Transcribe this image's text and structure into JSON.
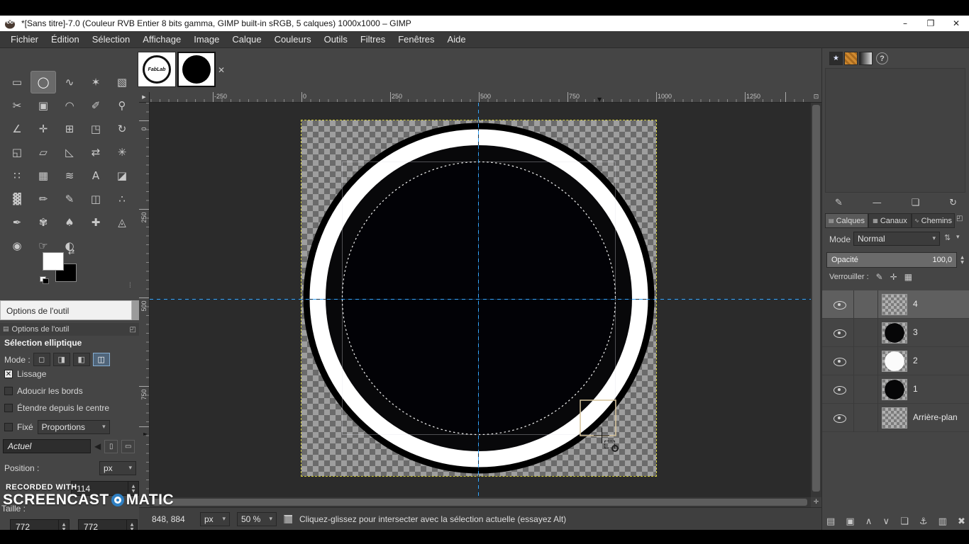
{
  "window": {
    "title": "*[Sans titre]-7.0 (Couleur RVB Entier 8 bits gamma, GIMP built-in sRGB, 5 calques) 1000x1000 – GIMP"
  },
  "menu_items": [
    "Fichier",
    "Édition",
    "Sélection",
    "Affichage",
    "Image",
    "Calque",
    "Couleurs",
    "Outils",
    "Filtres",
    "Fenêtres",
    "Aide"
  ],
  "image_tabs": {
    "logo_text": "FabLab"
  },
  "rulers": {
    "h": [
      "-250",
      "0",
      "250",
      "500",
      "750",
      "1000",
      "1250"
    ],
    "v": [
      "0",
      "250",
      "500",
      "750"
    ]
  },
  "toolbox": {
    "active_tool": "ellipse-select",
    "tools": [
      {
        "name": "rectangle-select",
        "glyph": "▭"
      },
      {
        "name": "ellipse-select",
        "glyph": "◯",
        "active": true
      },
      {
        "name": "free-select",
        "glyph": "∿"
      },
      {
        "name": "fuzzy-select",
        "glyph": "✶"
      },
      {
        "name": "select-by-color",
        "glyph": "▧"
      },
      {
        "name": "scissors-select",
        "glyph": "✂"
      },
      {
        "name": "foreground-select",
        "glyph": "▣"
      },
      {
        "name": "paths",
        "glyph": "◠"
      },
      {
        "name": "color-picker",
        "glyph": "✐"
      },
      {
        "name": "zoom",
        "glyph": "⚲"
      },
      {
        "name": "measure",
        "glyph": "∠"
      },
      {
        "name": "move",
        "glyph": "✛"
      },
      {
        "name": "alignment",
        "glyph": "⊞"
      },
      {
        "name": "crop",
        "glyph": "◳"
      },
      {
        "name": "rotate",
        "glyph": "↻"
      },
      {
        "name": "scale",
        "glyph": "◱"
      },
      {
        "name": "shear",
        "glyph": "▱"
      },
      {
        "name": "perspective",
        "glyph": "◺"
      },
      {
        "name": "flip",
        "glyph": "⇄"
      },
      {
        "name": "unified-transform",
        "glyph": "✳"
      },
      {
        "name": "handle-transform",
        "glyph": "∷"
      },
      {
        "name": "cage-transform",
        "glyph": "▦"
      },
      {
        "name": "warp-transform",
        "glyph": "≋"
      },
      {
        "name": "text",
        "glyph": "A"
      },
      {
        "name": "bucket-fill",
        "glyph": "◪"
      },
      {
        "name": "gradient",
        "glyph": "▓"
      },
      {
        "name": "pencil",
        "glyph": "✏"
      },
      {
        "name": "paintbrush",
        "glyph": "✎"
      },
      {
        "name": "eraser",
        "glyph": "◫"
      },
      {
        "name": "airbrush",
        "glyph": "∴"
      },
      {
        "name": "ink",
        "glyph": "✒"
      },
      {
        "name": "mypaint-brush",
        "glyph": "✾"
      },
      {
        "name": "clone",
        "glyph": "♠"
      },
      {
        "name": "heal",
        "glyph": "✚"
      },
      {
        "name": "perspective-clone",
        "glyph": "◬"
      },
      {
        "name": "blur-sharpen",
        "glyph": "◉"
      },
      {
        "name": "smudge",
        "glyph": "☞"
      },
      {
        "name": "dodge-burn",
        "glyph": "◐"
      }
    ]
  },
  "tool_options": {
    "floating_title": "Options de l'outil",
    "panel_title": "Options de l'outil",
    "tool_name": "Sélection elliptique",
    "mode_label": "Mode :",
    "antialias_label": "Lissage",
    "feather_label": "Adoucir les bords",
    "expand_label": "Étendre depuis le centre",
    "fixed_label": "Fixé",
    "fixed_value": "Proportions",
    "current_value": "Actuel",
    "position_label": "Position :",
    "unit": "px",
    "x_value": "114",
    "size_label": "Taille :",
    "width_value": "772",
    "height_value": "772"
  },
  "statusbar": {
    "position": "848, 884",
    "unit": "px",
    "zoom": "50 %",
    "message": "Cliquez-glissez pour intersecter avec la sélection actuelle (essayez Alt)"
  },
  "right_panel": {
    "tabs": [
      {
        "label": "Calques",
        "active": true
      },
      {
        "label": "Canaux",
        "active": false
      },
      {
        "label": "Chemins",
        "active": false
      }
    ],
    "mode_label": "Mode",
    "mode_value": "Normal",
    "opacity_label": "Opacité",
    "opacity_value": "100,0",
    "lock_label": "Verrouiller :",
    "layers": [
      {
        "name": "4",
        "thumb": "checker",
        "selected": true
      },
      {
        "name": "3",
        "thumb": "black-circle",
        "selected": false
      },
      {
        "name": "2",
        "thumb": "white-circle",
        "selected": false
      },
      {
        "name": "1",
        "thumb": "black-circle",
        "selected": false
      },
      {
        "name": "Arrière-plan",
        "thumb": "checker",
        "selected": false
      }
    ]
  },
  "watermark": {
    "line1": "RECORDED WITH",
    "brand_left": "SCREENCAST",
    "brand_right": "MATIC"
  },
  "icons": {
    "window_minimize": "–",
    "window_restore": "❐",
    "window_close": "✕",
    "tab_close": "✕",
    "ruler_corner": "▶",
    "canvas_menu": "⊡",
    "nav_cross": "✛",
    "combo_arrow": "▾",
    "spin_up": "▲",
    "spin_down": "▼",
    "mode_replace": "◻",
    "mode_add": "◨",
    "mode_subtract": "◧",
    "mode_intersect": "◫",
    "prev_value": "◀",
    "portrait": "▯",
    "landscape": "▭",
    "dock_tab": "▤",
    "dock_corner": "◰",
    "swap_colors": "⇄",
    "check_mark": "✕",
    "help": "?",
    "brush_edit": "✎",
    "brush_new": "—",
    "brush_duplicate": "❏",
    "brush_refresh": "↻",
    "tab_calques_icon": "▤",
    "tab_canaux_icon": "▦",
    "tab_chemins_icon": "∿",
    "mode_switch": "⇅",
    "lock_paint": "✎",
    "lock_move": "✛",
    "lock_alpha": "▦",
    "layer_new": "▤",
    "layer_group": "▣",
    "layer_up": "∧",
    "layer_down": "∨",
    "layer_duplicate": "❏",
    "layer_anchor": "⚓",
    "layer_merge": "▥",
    "layer_delete": "✖",
    "marker_down": "▼",
    "marker_right": "►"
  },
  "colors": {
    "guide_blue": "#35a6ff",
    "layer_boundary_yellow": "#d2cc3f",
    "titlebar_bg": "#ffffff",
    "panel_bg": "#454545",
    "checker_light": "#9e9e9e",
    "checker_dark": "#6b6b6b",
    "watermark_blue": "#2e7fc2"
  }
}
